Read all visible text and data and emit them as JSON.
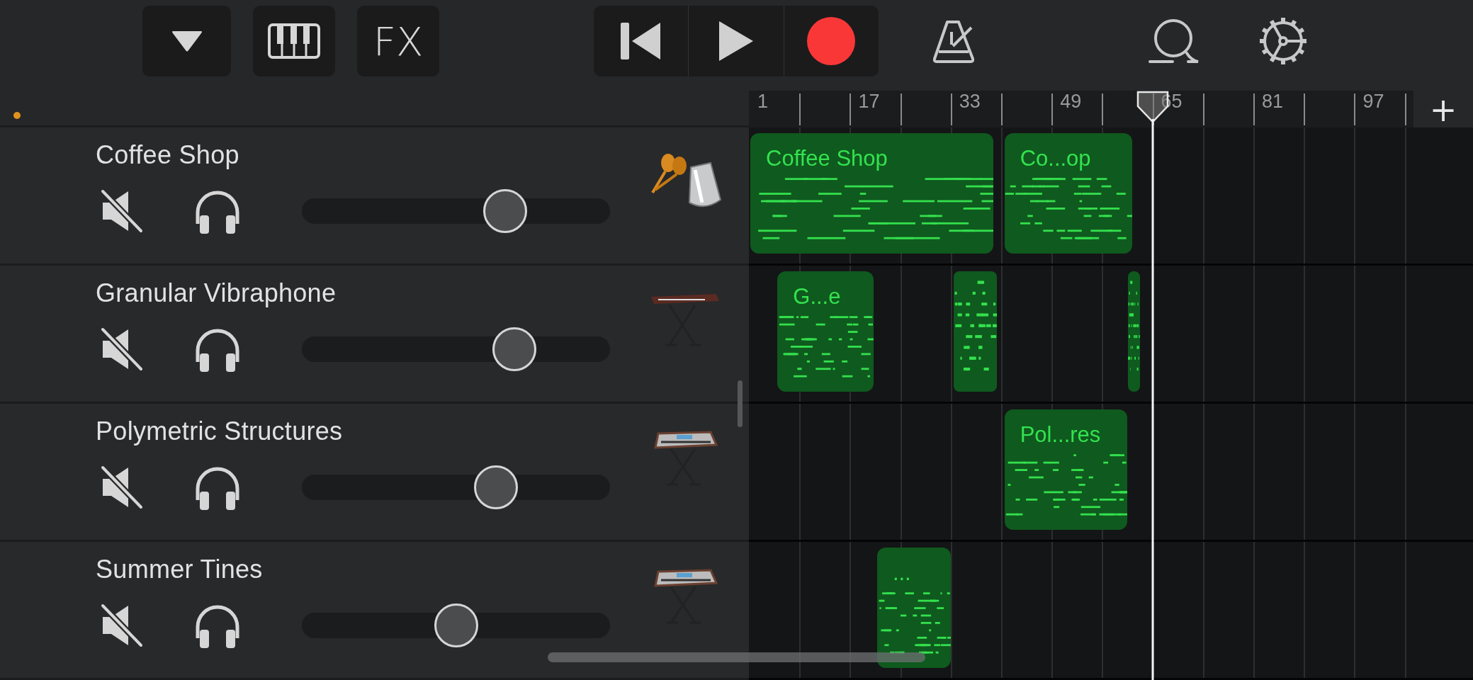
{
  "toolbar": {
    "fx_label": "FX"
  },
  "ruler": {
    "labels": [
      "1",
      "17",
      "33",
      "49",
      "65",
      "81",
      "97"
    ],
    "add_label": "+"
  },
  "playhead": {
    "level": 0.558
  },
  "tracks": [
    {
      "name": "Coffee Shop",
      "volume": {
        "level": 0.66
      },
      "instrument": {
        "kind": "percussion"
      },
      "regions": [
        {
          "kind": "titled",
          "title": "Coffee Shop"
        },
        {
          "kind": "titled",
          "title": "Co...op"
        }
      ]
    },
    {
      "name": "Granular Vibraphone",
      "volume": {
        "level": 0.69
      },
      "instrument": {
        "kind": "keyboard"
      },
      "regions": [
        {
          "kind": "titled",
          "title": "G...e"
        },
        {
          "kind": "plain"
        },
        {
          "kind": "plain"
        }
      ]
    },
    {
      "name": "Polymetric Structures",
      "volume": {
        "level": 0.63
      },
      "instrument": {
        "kind": "synth"
      },
      "regions": [
        {
          "kind": "titled",
          "title": "Pol...res"
        }
      ]
    },
    {
      "name": "Summer Tines",
      "volume": {
        "level": 0.5
      },
      "instrument": {
        "kind": "synth"
      },
      "regions": [
        {
          "kind": "titled",
          "title": "..."
        }
      ]
    }
  ]
}
